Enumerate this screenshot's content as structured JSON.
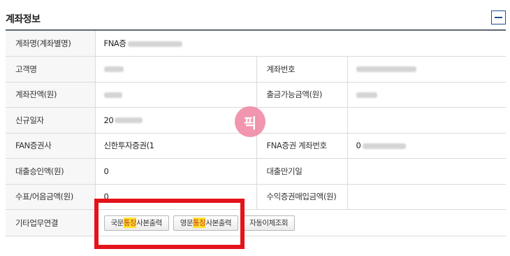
{
  "section": {
    "title": "계좌정보",
    "collapse_icon": "minus-icon"
  },
  "rows": [
    {
      "label": "계좌명(계좌별명)",
      "value": "FNA증"
    },
    {
      "label": "고객명",
      "value": "",
      "label2": "계좌번호",
      "value2": ""
    },
    {
      "label": "계좌잔액(원)",
      "value": "",
      "label2": "출금가능금액(원)",
      "value2": ""
    },
    {
      "label": "신규일자",
      "value": "20",
      "label2": "",
      "value2": ""
    },
    {
      "label": "FAN증권사",
      "value": "신한투자증권(1",
      "label2": "FNA증권 계좌번호",
      "value2": "0"
    },
    {
      "label": "대출승인액(원)",
      "value": "0",
      "label2": "대출만기일",
      "value2": ""
    },
    {
      "label": "수표/어음금액(원)",
      "value": "0",
      "label2": "수익증권매입금액(원)",
      "value2": ""
    },
    {
      "label": "기타업무연결"
    }
  ],
  "buttons": {
    "b1_pre": "국문",
    "b1_hl": "통장",
    "b1_post": "사본출력",
    "b2_pre": "영문",
    "b2_hl": "통장",
    "b2_post": "사본출력",
    "b3": "자동이체조회"
  },
  "watermark": {
    "text": "픽"
  },
  "colors": {
    "accent": "#1d4f91",
    "highlight": "#ffe22a",
    "annotation": "#e4131a",
    "watermark": "#f08ba6"
  }
}
